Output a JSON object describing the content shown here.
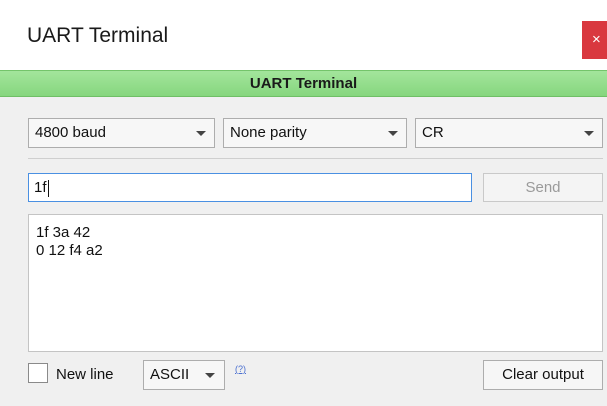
{
  "window": {
    "title": "UART Terminal",
    "close_glyph": "×"
  },
  "header": {
    "title": "UART Terminal",
    "color": "#8ddc84"
  },
  "settings": {
    "baud": "4800 baud",
    "parity": "None parity",
    "line_ending": "CR"
  },
  "input": {
    "value": "1f"
  },
  "send_button": {
    "label": "Send"
  },
  "output": {
    "lines": [
      "1f 3a 42",
      "0 12 f4 a2"
    ]
  },
  "footer": {
    "newline_label": "New line",
    "newline_checked": false,
    "format": "ASCII",
    "help_link": "(?)",
    "clear_label": "Clear output"
  },
  "icons": {
    "close": "close-icon",
    "dropdown": "chevron-down-icon"
  }
}
